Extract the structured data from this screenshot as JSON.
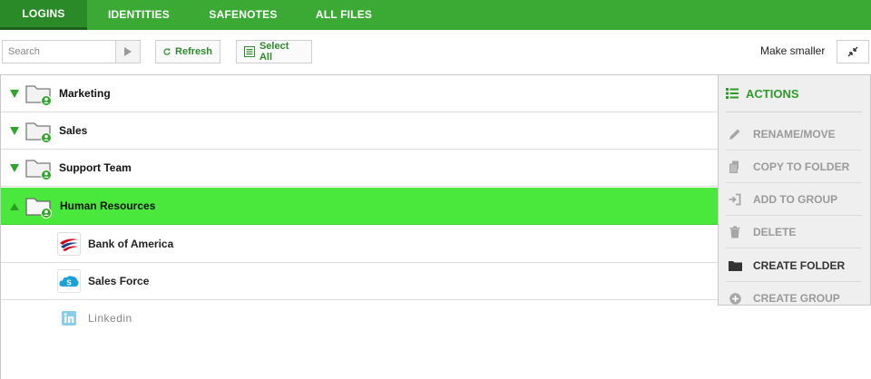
{
  "tabs": [
    {
      "label": "LOGINS",
      "active": true
    },
    {
      "label": "IDENTITIES",
      "active": false
    },
    {
      "label": "SAFENOTES",
      "active": false
    },
    {
      "label": "ALL FILES",
      "active": false
    }
  ],
  "toolbar": {
    "search_placeholder": "Search",
    "refresh_label": "Refresh",
    "select_all_label": "Select All",
    "make_smaller_label": "Make smaller"
  },
  "folders": [
    {
      "label": "Marketing",
      "expanded": false,
      "selected": false
    },
    {
      "label": "Sales",
      "expanded": false,
      "selected": false
    },
    {
      "label": "Support Team",
      "expanded": false,
      "selected": false
    },
    {
      "label": "Human Resources",
      "expanded": true,
      "selected": true
    }
  ],
  "logins": [
    {
      "label": "Bank of America",
      "icon": "bank-of-america-logo"
    },
    {
      "label": "Sales Force",
      "icon": "salesforce-logo"
    },
    {
      "label": "Linkedin",
      "icon": "linkedin-logo"
    }
  ],
  "actions": {
    "title": "ACTIONS",
    "items": [
      {
        "label": "RENAME/MOVE",
        "icon": "pencil-icon",
        "enabled": false
      },
      {
        "label": "COPY TO FOLDER",
        "icon": "copy-icon",
        "enabled": false
      },
      {
        "label": "ADD TO GROUP",
        "icon": "sign-in-icon",
        "enabled": false
      },
      {
        "label": "DELETE",
        "icon": "trash-icon",
        "enabled": false
      },
      {
        "label": "CREATE FOLDER",
        "icon": "folder-icon",
        "enabled": true
      },
      {
        "label": "CREATE GROUP",
        "icon": "plus-circle-icon",
        "enabled": false
      }
    ]
  },
  "colors": {
    "brand_green": "#3aaa35",
    "active_tab": "#2b8a28",
    "selected_row": "#4ae83c",
    "action_green": "#2e9b2a"
  }
}
